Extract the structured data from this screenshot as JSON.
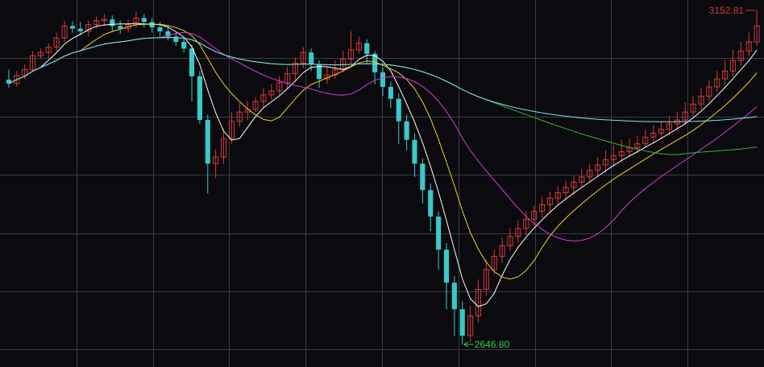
{
  "chart_data": {
    "type": "candlestick",
    "ylim": [
      2620,
      3160
    ],
    "grid": true,
    "colors": {
      "background": "#0b0b0f",
      "grid": "#3a3d45",
      "up": "#d23a3a",
      "down": "#3cc8c8",
      "ma5": "#ffffff",
      "ma10": "#f2d22a",
      "ma20": "#d63ad6",
      "ma60": "#35b535",
      "ma120": "#7fe3ec"
    },
    "annotations": {
      "high_label": "3152.81",
      "low_label": "2646.80",
      "high_color": "#d23a3a",
      "low_color": "#3cc83c"
    },
    "candles": [
      [
        3047,
        3041,
        3062,
        3035
      ],
      [
        3041,
        3053,
        3060,
        3036
      ],
      [
        3053,
        3062,
        3070,
        3048
      ],
      [
        3062,
        3083,
        3090,
        3058
      ],
      [
        3083,
        3088,
        3094,
        3078
      ],
      [
        3088,
        3096,
        3102,
        3080
      ],
      [
        3096,
        3110,
        3118,
        3090
      ],
      [
        3110,
        3128,
        3136,
        3104
      ],
      [
        3128,
        3124,
        3135,
        3118
      ],
      [
        3124,
        3120,
        3134,
        3114
      ],
      [
        3120,
        3130,
        3136,
        3112
      ],
      [
        3130,
        3136,
        3142,
        3124
      ],
      [
        3136,
        3138,
        3146,
        3128
      ],
      [
        3138,
        3128,
        3144,
        3120
      ],
      [
        3128,
        3124,
        3136,
        3116
      ],
      [
        3124,
        3130,
        3138,
        3118
      ],
      [
        3130,
        3140,
        3150,
        3126
      ],
      [
        3140,
        3134,
        3146,
        3126
      ],
      [
        3134,
        3126,
        3140,
        3118
      ],
      [
        3126,
        3120,
        3134,
        3112
      ],
      [
        3120,
        3112,
        3128,
        3106
      ],
      [
        3112,
        3104,
        3118,
        3098
      ],
      [
        3104,
        3094,
        3110,
        3088
      ],
      [
        3094,
        3052,
        3100,
        3014
      ],
      [
        3052,
        2986,
        3060,
        2980
      ],
      [
        2986,
        2920,
        2994,
        2875
      ],
      [
        2920,
        2930,
        2942,
        2898
      ],
      [
        2930,
        2958,
        2972,
        2920
      ],
      [
        2958,
        2984,
        2998,
        2950
      ],
      [
        2984,
        2998,
        3012,
        2976
      ],
      [
        2998,
        3002,
        3014,
        2986
      ],
      [
        3002,
        3014,
        3020,
        2998
      ],
      [
        3014,
        3024,
        3034,
        3004
      ],
      [
        3024,
        3030,
        3040,
        3016
      ],
      [
        3030,
        3042,
        3052,
        3024
      ],
      [
        3042,
        3056,
        3066,
        3034
      ],
      [
        3056,
        3072,
        3080,
        3046
      ],
      [
        3072,
        3088,
        3096,
        3064
      ],
      [
        3088,
        3070,
        3094,
        3060
      ],
      [
        3070,
        3048,
        3076,
        3034
      ],
      [
        3048,
        3054,
        3066,
        3040
      ],
      [
        3054,
        3062,
        3076,
        3048
      ],
      [
        3062,
        3078,
        3090,
        3058
      ],
      [
        3078,
        3092,
        3120,
        3070
      ],
      [
        3092,
        3102,
        3112,
        3086
      ],
      [
        3102,
        3086,
        3108,
        3072
      ],
      [
        3086,
        3058,
        3090,
        3040
      ],
      [
        3058,
        3036,
        3066,
        3022
      ],
      [
        3036,
        3018,
        3044,
        3004
      ],
      [
        3018,
        2984,
        3026,
        2950
      ],
      [
        2984,
        2956,
        2994,
        2940
      ],
      [
        2956,
        2920,
        2966,
        2900
      ],
      [
        2920,
        2880,
        2928,
        2860
      ],
      [
        2880,
        2840,
        2890,
        2818
      ],
      [
        2840,
        2790,
        2848,
        2760
      ],
      [
        2790,
        2740,
        2800,
        2700
      ],
      [
        2740,
        2700,
        2750,
        2660
      ],
      [
        2700,
        2660,
        2712,
        2646.8
      ],
      [
        2660,
        2690,
        2705,
        2650
      ],
      [
        2690,
        2730,
        2745,
        2680
      ],
      [
        2730,
        2760,
        2775,
        2720
      ],
      [
        2760,
        2780,
        2790,
        2752
      ],
      [
        2780,
        2796,
        2808,
        2770
      ],
      [
        2796,
        2810,
        2822,
        2788
      ],
      [
        2810,
        2822,
        2834,
        2800
      ],
      [
        2822,
        2836,
        2848,
        2812
      ],
      [
        2836,
        2848,
        2856,
        2826
      ],
      [
        2848,
        2858,
        2870,
        2838
      ],
      [
        2858,
        2868,
        2878,
        2846
      ],
      [
        2868,
        2876,
        2886,
        2858
      ],
      [
        2876,
        2884,
        2894,
        2864
      ],
      [
        2884,
        2892,
        2902,
        2872
      ],
      [
        2892,
        2900,
        2912,
        2884
      ],
      [
        2900,
        2910,
        2920,
        2892
      ],
      [
        2910,
        2918,
        2930,
        2900
      ],
      [
        2918,
        2926,
        2940,
        2906
      ],
      [
        2926,
        2932,
        2948,
        2916
      ],
      [
        2932,
        2938,
        2956,
        2922
      ],
      [
        2938,
        2944,
        2958,
        2930
      ],
      [
        2944,
        2950,
        2962,
        2936
      ],
      [
        2950,
        2960,
        2972,
        2944
      ],
      [
        2960,
        2966,
        2978,
        2950
      ],
      [
        2966,
        2972,
        2984,
        2956
      ],
      [
        2972,
        2980,
        2992,
        2962
      ],
      [
        2980,
        2986,
        2998,
        2970
      ],
      [
        2986,
        2998,
        3012,
        2978
      ],
      [
        2998,
        3010,
        3022,
        2990
      ],
      [
        3010,
        3022,
        3034,
        3002
      ],
      [
        3022,
        3036,
        3046,
        3014
      ],
      [
        3036,
        3048,
        3060,
        3028
      ],
      [
        3048,
        3060,
        3076,
        3040
      ],
      [
        3060,
        3076,
        3092,
        3052
      ],
      [
        3076,
        3090,
        3104,
        3068
      ],
      [
        3090,
        3104,
        3118,
        3082
      ],
      [
        3104,
        3128,
        3152.81,
        3098
      ]
    ]
  }
}
